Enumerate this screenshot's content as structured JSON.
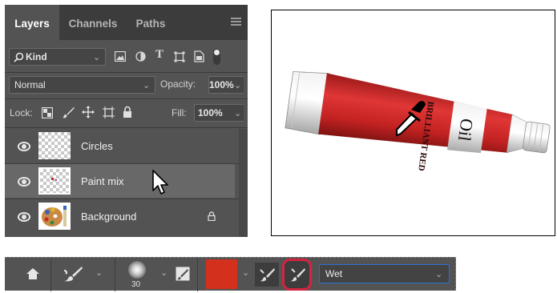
{
  "layers_panel": {
    "tabs": [
      "Layers",
      "Channels",
      "Paths"
    ],
    "filter": {
      "label": "Kind"
    },
    "blend_mode": "Normal",
    "opacity": {
      "label": "Opacity:",
      "value": "100%"
    },
    "lock": {
      "label": "Lock:"
    },
    "fill": {
      "label": "Fill:",
      "value": "100%"
    },
    "layers": [
      {
        "name": "Circles",
        "visible": true,
        "selected": false
      },
      {
        "name": "Paint mix",
        "visible": true,
        "selected": true
      },
      {
        "name": "Background",
        "visible": true,
        "selected": false,
        "locked": true
      }
    ]
  },
  "canvas": {
    "tube_brand_text": "BRILLIANT RED",
    "tube_label_text": "Oil"
  },
  "options_bar": {
    "brush_size": "30",
    "current_color": "#d4301e",
    "mix_preset": "Wet"
  },
  "colors": {
    "panel_bg": "#535353",
    "selected_row": "#686868",
    "highlight_ring": "#d4243f"
  }
}
